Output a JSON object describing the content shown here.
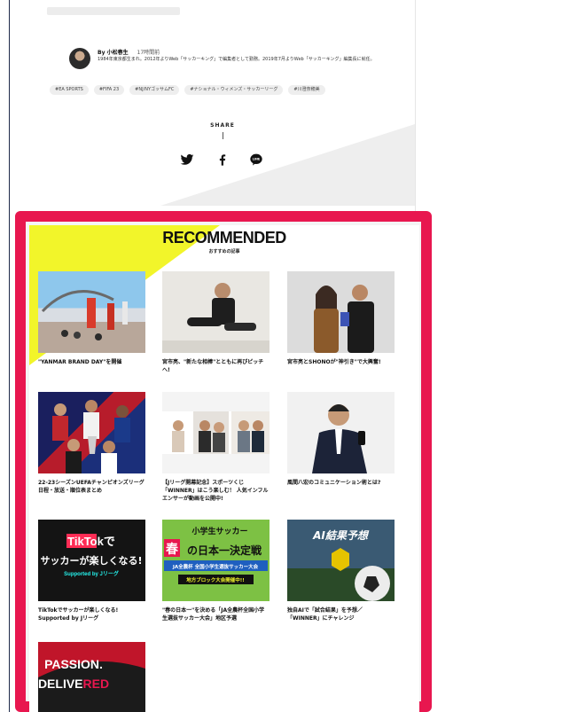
{
  "author": {
    "name": "By 小松春生",
    "time": "17時間前",
    "bio": "1984年東京都生まれ。2012年よりWeb「サッカーキング」で編集者として勤務。2019年7月よりWeb「サッカーキング」編集長に就任。"
  },
  "tags": [
    "#EA SPORTS",
    "#FIFA 23",
    "#NJ/NYゴッサムFC",
    "#ナショナル・ウィメンズ・サッカーリーグ",
    "#川澄奈穂美"
  ],
  "share": {
    "label": "SHARE",
    "icons": [
      "twitter-icon",
      "facebook-icon",
      "line-icon"
    ],
    "line_text": "LINE"
  },
  "recommended": {
    "title": "RECOMMENDED",
    "subtitle": "おすすめの記事",
    "articles": [
      {
        "caption": "\"YANMAR BRAND DAY\"を開催"
      },
      {
        "caption": "宮市亮、\"新たな相棒\"とともに再びピッチへ!"
      },
      {
        "caption": "宮市亮とSHONOが\"神引き\"で大興奮!"
      },
      {
        "caption": "22-23シーズンUEFAチャンピオンズリーグ日程・放送・順位表まとめ"
      },
      {
        "caption": "【Jリーグ開幕記念】スポーツくじ「WINNER」はこう楽しむ！ 人気インフルエンサーが動画を公開中!"
      },
      {
        "caption": "風間八宏のコミュニケーション術とは?"
      },
      {
        "caption": "TikTokでサッカーが楽しくなる! Supported by Jリーグ"
      },
      {
        "caption": "\"春の日本一\"を決める「JA全農杯全国小学生選抜サッカー大会」地区予選"
      },
      {
        "caption": "独自AIで「試合結果」を予想／「WINNER」にチャレンジ"
      },
      {
        "caption": ""
      }
    ],
    "thumb_text": {
      "tiktok_logo": "TikTokで",
      "tiktok_line": "サッカーが楽しくなる!",
      "tiktok_sub": "Supported by Jリーグ",
      "ja_top": "小学生サッカー",
      "ja_main": "の日本一決定戦",
      "ja_spring": "春",
      "ja_band": "JA全農杯 全国小学生選抜サッカー大会",
      "ja_sub": "地方ブロック大会開催中!!",
      "ai_title": "AI結果予想",
      "passion_1": "PASSION.",
      "passion_2a": "DELIVE",
      "passion_2b": "RED"
    }
  },
  "colors": {
    "accent_border": "#e8174f",
    "yellow": "#f2f52a"
  }
}
